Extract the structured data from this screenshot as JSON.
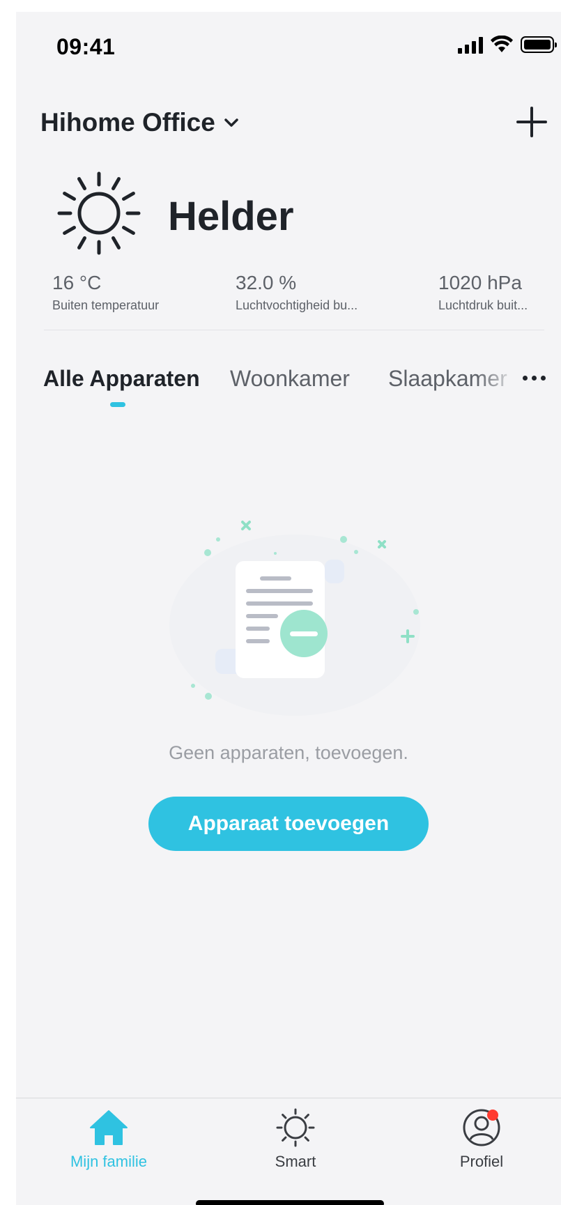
{
  "status_bar": {
    "time": "09:41"
  },
  "header": {
    "home_name": "Hihome Office",
    "add_icon": "plus-icon",
    "dropdown_icon": "chevron-down-icon"
  },
  "weather": {
    "icon": "sun-icon",
    "condition": "Helder",
    "stats": [
      {
        "value": "16 °C",
        "label": "Buiten temperatuur"
      },
      {
        "value": "32.0 %",
        "label": "Luchtvochtigheid bu..."
      },
      {
        "value": "1020 hPa",
        "label": "Luchtdruk buit..."
      }
    ]
  },
  "tabs": {
    "items": [
      {
        "label": "Alle Apparaten",
        "active": true
      },
      {
        "label": "Woonkamer",
        "active": false
      },
      {
        "label": "Slaapkamer",
        "active": false
      }
    ],
    "more_icon": "more-horizontal-icon"
  },
  "empty_state": {
    "message": "Geen apparaten, toevoegen.",
    "button_label": "Apparaat toevoegen"
  },
  "bottom_nav": {
    "items": [
      {
        "label": "Mijn familie",
        "icon": "home-icon",
        "active": true
      },
      {
        "label": "Smart",
        "icon": "sun-icon",
        "active": false
      },
      {
        "label": "Profiel",
        "icon": "user-icon",
        "active": false
      }
    ]
  },
  "colors": {
    "accent": "#2fc2e1",
    "background": "#f4f4f6",
    "text_primary": "#1f2329",
    "text_secondary": "#5d6168",
    "notification": "#ff3b30",
    "illustration_green": "#9ee5cf"
  }
}
